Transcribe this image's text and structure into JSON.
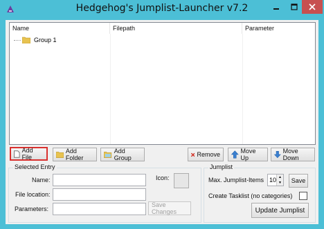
{
  "window": {
    "title": "Hedgehog's Jumplist-Launcher v7.2"
  },
  "tree": {
    "columns": [
      "Name",
      "Filepath",
      "Parameter"
    ],
    "items": [
      {
        "label": "Group 1"
      }
    ]
  },
  "toolbar": {
    "add_file": "Add File",
    "add_folder": "Add Folder",
    "add_group": "Add Group",
    "remove": "Remove",
    "move_up": "Move Up",
    "move_down": "Move Down"
  },
  "selected_entry": {
    "title": "Selected Entry",
    "name_label": "Name:",
    "location_label": "File location:",
    "parameters_label": "Parameters:",
    "icon_label": "Icon:",
    "name_value": "",
    "location_value": "",
    "parameters_value": "",
    "save_changes": "Save Changes"
  },
  "jumplist": {
    "title": "Jumplist",
    "max_items_label": "Max. Jumplist-Items",
    "max_items_value": "10",
    "save": "Save",
    "tasklist_label": "Create Tasklist (no categories)",
    "tasklist_checked": false,
    "update": "Update Jumplist"
  },
  "colors": {
    "frame": "#4cbfd6",
    "close": "#c75050",
    "highlight": "#d9302e"
  }
}
